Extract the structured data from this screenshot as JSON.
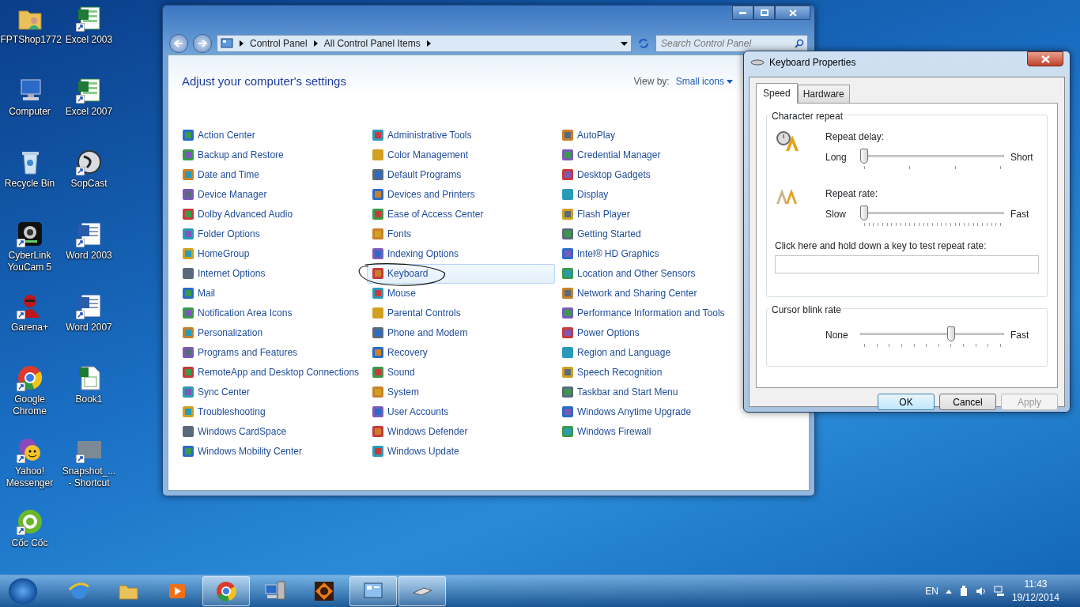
{
  "desktop_icons": [
    {
      "label": "FPTShop1772",
      "kind": "user-folder",
      "shortcut": false
    },
    {
      "label": "Excel 2003",
      "kind": "spreadsheet",
      "shortcut": true
    },
    {
      "label": "Computer",
      "kind": "computer",
      "shortcut": false
    },
    {
      "label": "Excel 2007",
      "kind": "spreadsheet",
      "shortcut": true
    },
    {
      "label": "Recycle Bin",
      "kind": "bin",
      "shortcut": false
    },
    {
      "label": "SopCast",
      "kind": "disc",
      "shortcut": true
    },
    {
      "label": "CyberLink YouCam 5",
      "kind": "webcam",
      "shortcut": true
    },
    {
      "label": "Word 2003",
      "kind": "document",
      "shortcut": true
    },
    {
      "label": "Garena+",
      "kind": "figure",
      "shortcut": true
    },
    {
      "label": "Word 2007",
      "kind": "document",
      "shortcut": true
    },
    {
      "label": "Google Chrome",
      "kind": "chrome",
      "shortcut": true
    },
    {
      "label": "Book1",
      "kind": "sheet-file",
      "shortcut": false
    },
    {
      "label": "Yahoo! Messenger",
      "kind": "smiley",
      "shortcut": true
    },
    {
      "label": "Snapshot_... - Shortcut",
      "kind": "photo",
      "shortcut": true
    },
    {
      "label": "Cốc Cốc",
      "kind": "coccoc",
      "shortcut": true
    }
  ],
  "explorer": {
    "breadcrumb": [
      "Control Panel",
      "All Control Panel Items"
    ],
    "search": {
      "placeholder": "Search Control Panel"
    },
    "heading": "Adjust your computer's settings",
    "view_by_label": "View by:",
    "view_by_value": "Small icons",
    "columns": [
      [
        {
          "label": "Action Center",
          "selected": false
        },
        {
          "label": "Backup and Restore",
          "selected": false
        },
        {
          "label": "Date and Time",
          "selected": false
        },
        {
          "label": "Device Manager",
          "selected": false
        },
        {
          "label": "Dolby Advanced Audio",
          "selected": false
        },
        {
          "label": "Folder Options",
          "selected": false
        },
        {
          "label": "HomeGroup",
          "selected": false
        },
        {
          "label": "Internet Options",
          "selected": false
        },
        {
          "label": "Mail",
          "selected": false
        },
        {
          "label": "Notification Area Icons",
          "selected": false
        },
        {
          "label": "Personalization",
          "selected": false
        },
        {
          "label": "Programs and Features",
          "selected": false
        },
        {
          "label": "RemoteApp and Desktop Connections",
          "selected": false
        },
        {
          "label": "Sync Center",
          "selected": false
        },
        {
          "label": "Troubleshooting",
          "selected": false
        },
        {
          "label": "Windows CardSpace",
          "selected": false
        },
        {
          "label": "Windows Mobility Center",
          "selected": false
        }
      ],
      [
        {
          "label": "Administrative Tools",
          "selected": false
        },
        {
          "label": "Color Management",
          "selected": false
        },
        {
          "label": "Default Programs",
          "selected": false
        },
        {
          "label": "Devices and Printers",
          "selected": false
        },
        {
          "label": "Ease of Access Center",
          "selected": false
        },
        {
          "label": "Fonts",
          "selected": false
        },
        {
          "label": "Indexing Options",
          "selected": false
        },
        {
          "label": "Keyboard",
          "selected": true
        },
        {
          "label": "Mouse",
          "selected": false
        },
        {
          "label": "Parental Controls",
          "selected": false
        },
        {
          "label": "Phone and Modem",
          "selected": false
        },
        {
          "label": "Recovery",
          "selected": false
        },
        {
          "label": "Sound",
          "selected": false
        },
        {
          "label": "System",
          "selected": false
        },
        {
          "label": "User Accounts",
          "selected": false
        },
        {
          "label": "Windows Defender",
          "selected": false
        },
        {
          "label": "Windows Update",
          "selected": false
        }
      ],
      [
        {
          "label": "AutoPlay",
          "selected": false
        },
        {
          "label": "Credential Manager",
          "selected": false
        },
        {
          "label": "Desktop Gadgets",
          "selected": false
        },
        {
          "label": "Display",
          "selected": false
        },
        {
          "label": "Flash Player",
          "selected": false
        },
        {
          "label": "Getting Started",
          "selected": false
        },
        {
          "label": "Intel® HD Graphics",
          "selected": false
        },
        {
          "label": "Location and Other Sensors",
          "selected": false
        },
        {
          "label": "Network and Sharing Center",
          "selected": false
        },
        {
          "label": "Performance Information and Tools",
          "selected": false
        },
        {
          "label": "Power Options",
          "selected": false
        },
        {
          "label": "Region and Language",
          "selected": false
        },
        {
          "label": "Speech Recognition",
          "selected": false
        },
        {
          "label": "Taskbar and Start Menu",
          "selected": false
        },
        {
          "label": "Windows Anytime Upgrade",
          "selected": false
        },
        {
          "label": "Windows Firewall",
          "selected": false
        }
      ]
    ]
  },
  "dialog": {
    "title": "Keyboard Properties",
    "tabs": [
      {
        "label": "Speed",
        "selected": true
      },
      {
        "label": "Hardware",
        "selected": false
      }
    ],
    "character_repeat": {
      "title": "Character repeat",
      "repeat_delay": {
        "label": "Repeat delay:",
        "min_label": "Long",
        "max_label": "Short",
        "level": 0
      },
      "repeat_rate": {
        "label": "Repeat rate:",
        "min_label": "Slow",
        "max_label": "Fast",
        "level": 0
      },
      "test_label": "Click here and hold down a key to test repeat rate:"
    },
    "cursor_blink": {
      "title": "Cursor blink rate",
      "min_label": "None",
      "max_label": "Fast",
      "level": 0.64
    },
    "buttons": [
      {
        "label": "OK",
        "default": true,
        "disabled": false
      },
      {
        "label": "Cancel",
        "default": false,
        "disabled": false
      },
      {
        "label": "Apply",
        "default": false,
        "disabled": true
      }
    ]
  },
  "taskbar": {
    "apps": [
      {
        "kind": "browser",
        "active": false
      },
      {
        "kind": "folder",
        "active": false
      },
      {
        "kind": "media",
        "active": false
      },
      {
        "kind": "chrome",
        "active": true
      },
      {
        "kind": "network",
        "active": false
      },
      {
        "kind": "game",
        "active": false
      },
      {
        "kind": "control-panel",
        "active": true
      },
      {
        "kind": "keyboard",
        "active": true
      }
    ],
    "language": "EN",
    "time": "11:43",
    "date": "19/12/2014"
  }
}
